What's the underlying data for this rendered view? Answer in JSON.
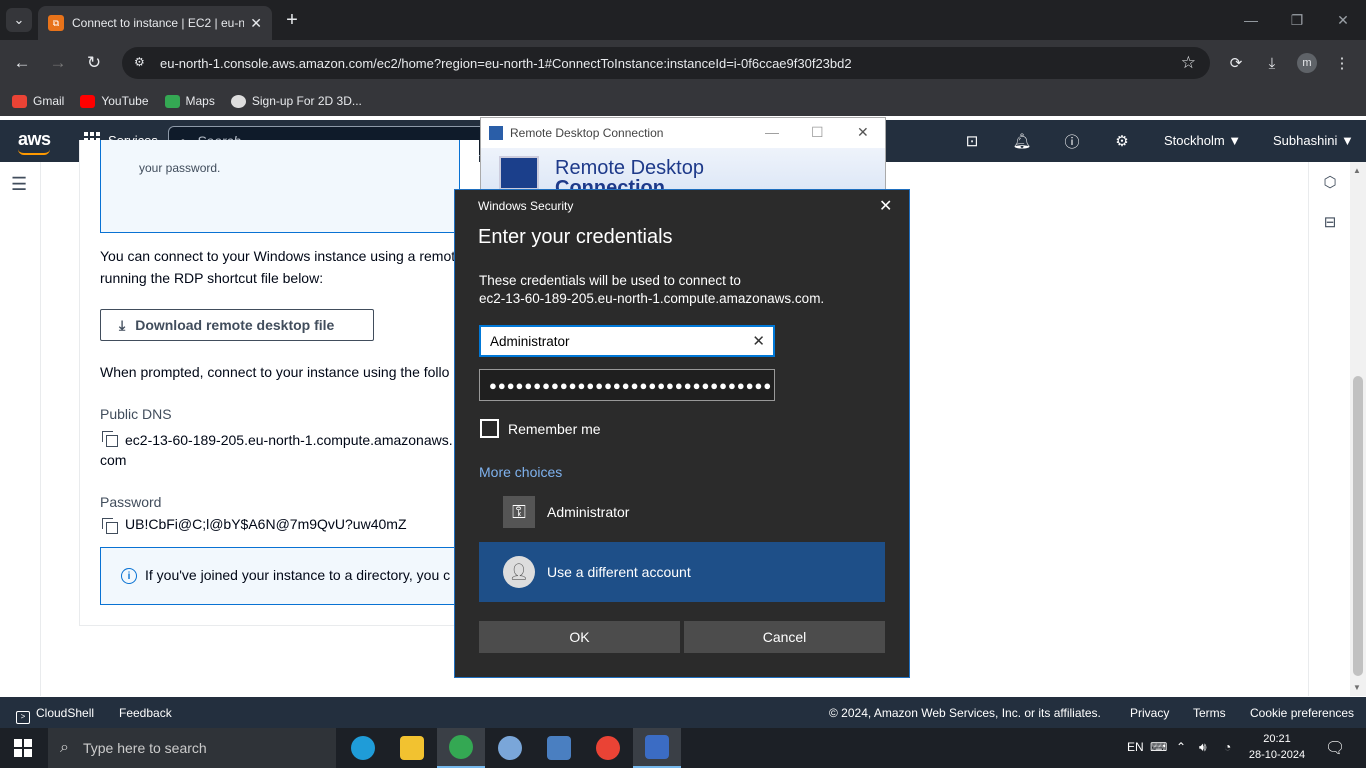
{
  "browser": {
    "tab_title": "Connect to instance | EC2 | eu-n",
    "url": "eu-north-1.console.aws.amazon.com/ec2/home?region=eu-north-1#ConnectToInstance:instanceId=i-0f6ccae9f30f23bd2",
    "profile_initial": "m",
    "bookmarks": [
      {
        "label": "Gmail",
        "color": "#ea4335"
      },
      {
        "label": "YouTube",
        "color": "#ff0000"
      },
      {
        "label": "Maps",
        "color": "#34a853"
      },
      {
        "label": "Sign-up For 2D 3D...",
        "color": "#dddddd"
      }
    ]
  },
  "aws_nav": {
    "logo": "aws",
    "services": "Services",
    "search_placeholder": "Search",
    "region": "Stockholm ▼",
    "user": "Subhashini ▼"
  },
  "content": {
    "alert_top_text": "your password.",
    "para1_line1": "You can connect to your Windows instance using a remot",
    "para1_line2": "running the RDP shortcut file below:",
    "download_button": "Download remote desktop file",
    "para2": "When prompted, connect to your instance using the follo",
    "public_dns_label": "Public DNS",
    "public_dns_line1": "ec2-13-60-189-205.eu-north-1.compute.amazonaws.",
    "public_dns_line2": "com",
    "password_label": "Password",
    "password_value": "UB!CbFi@C;l@bY$A6N@7m9QvU?uw40mZ",
    "info_text": "If you've joined your instance to a directory, you c"
  },
  "rdp_window": {
    "title": "Remote Desktop Connection",
    "brand_line1": "Remote Desktop",
    "brand_line2": "Connection"
  },
  "security_dialog": {
    "title": "Windows Security",
    "heading": "Enter your credentials",
    "desc_line1": "These credentials will be used to connect to",
    "desc_line2": "ec2-13-60-189-205.eu-north-1.compute.amazonaws.com.",
    "username": "Administrator",
    "password_mask": "●●●●●●●●●●●●●●●●●●●●●●●●●●●●●●●●",
    "remember_me": "Remember me",
    "more_choices": "More choices",
    "account1": "Administrator",
    "account2": "Use a different account",
    "ok": "OK",
    "cancel": "Cancel"
  },
  "aws_footer": {
    "cloudshell": "CloudShell",
    "feedback": "Feedback",
    "copyright": "© 2024, Amazon Web Services, Inc. or its affiliates.",
    "privacy": "Privacy",
    "terms": "Terms",
    "cookies": "Cookie preferences"
  },
  "taskbar": {
    "search_placeholder": "Type here to search",
    "language": "EN",
    "time": "20:21",
    "date": "28-10-2024",
    "apps": [
      {
        "name": "edge-icon",
        "color": "#1f9cd8"
      },
      {
        "name": "file-explorer-icon",
        "color": "#f2c230"
      },
      {
        "name": "chrome-icon",
        "color": "#34a853"
      },
      {
        "name": "paint-icon",
        "color": "#7aa6d9"
      },
      {
        "name": "calculator-icon",
        "color": "#4a7fc1"
      },
      {
        "name": "chrome-profile-icon",
        "color": "#ea4335"
      },
      {
        "name": "remote-desktop-icon",
        "color": "#3b6cc4"
      }
    ]
  }
}
